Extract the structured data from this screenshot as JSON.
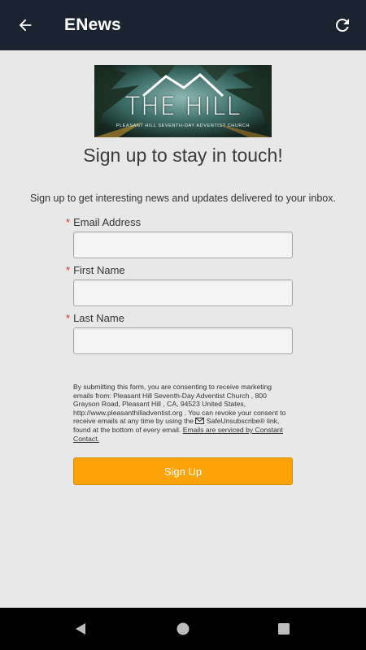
{
  "appbar": {
    "title": "ENews",
    "back_icon": "arrow-left-icon",
    "refresh_icon": "refresh-icon",
    "background": "#1b2330"
  },
  "logo": {
    "title": "THE HILL",
    "subtitle": "PLEASANT HILL SEVENTH-DAY ADVENTIST CHURCH"
  },
  "form": {
    "headline": "Sign up to stay in touch!",
    "intro": "Sign up to get interesting news and updates delivered to your inbox.",
    "required_marker": "*",
    "fields": [
      {
        "label": "Email Address",
        "value": ""
      },
      {
        "label": "First Name",
        "value": ""
      },
      {
        "label": "Last Name",
        "value": ""
      }
    ],
    "legal": {
      "text1": "By submitting this form, you are consenting to receive marketing emails from: Pleasant Hill Seventh-Day Adventist Church , 800 Grayson Road, Pleasant Hill , CA, 94523 United States, http://www.pleasanthilladventist.org . You can revoke your consent to receive emails at any time by using the",
      "safeunsubscribe": "SafeUnsubscribe®",
      "text2": "link, found at the bottom of every email.",
      "service_link": "Emails are serviced by Constant Contact."
    },
    "submit_label": "Sign Up",
    "accent": "#fca30a"
  },
  "navbar": {
    "back_icon": "triangle-back-icon",
    "home_icon": "circle-home-icon",
    "recents_icon": "square-recents-icon"
  }
}
